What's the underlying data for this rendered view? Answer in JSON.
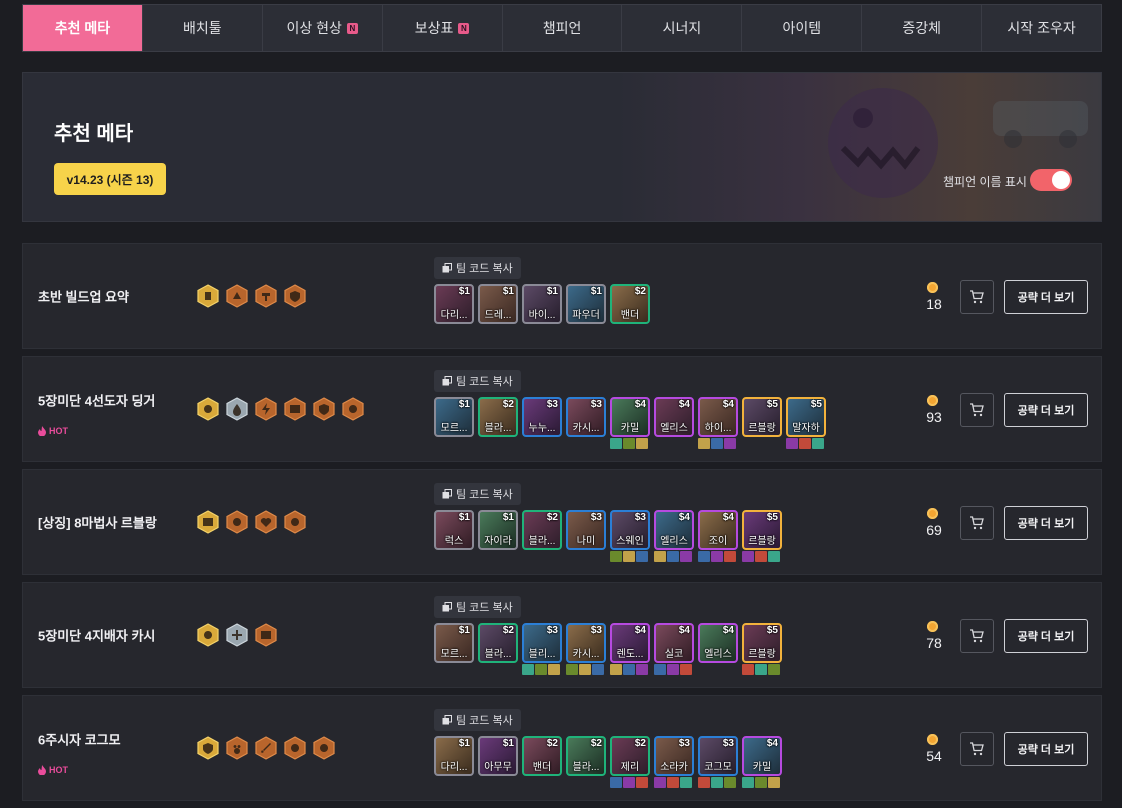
{
  "nav": {
    "items": [
      {
        "label": "추천 메타",
        "active": true,
        "badge": ""
      },
      {
        "label": "배치툴",
        "active": false,
        "badge": ""
      },
      {
        "label": "이상 현상",
        "active": false,
        "badge": "N"
      },
      {
        "label": "보상표",
        "active": false,
        "badge": "N"
      },
      {
        "label": "챔피언",
        "active": false,
        "badge": ""
      },
      {
        "label": "시너지",
        "active": false,
        "badge": ""
      },
      {
        "label": "아이템",
        "active": false,
        "badge": ""
      },
      {
        "label": "증강체",
        "active": false,
        "badge": ""
      },
      {
        "label": "시작 조우자",
        "active": false,
        "badge": ""
      }
    ]
  },
  "hero": {
    "title": "추천 메타",
    "version": "v14.23 (시즌 13)",
    "toggle_label": "챔피언 이름 표시",
    "toggle_on": true
  },
  "common": {
    "copy_label": "팀 코드 복사",
    "more_label": "공략 더 보기",
    "hot_label": "HOT"
  },
  "colors": {
    "accent": "#f26b97",
    "version_bg": "#f7d34a",
    "toggle": "#f2646a",
    "hot": "#e94c9b",
    "cost1": "#8a8a96",
    "cost2": "#1fb37a",
    "cost3": "#2b7fd6",
    "cost4": "#b64ae0",
    "cost5": "#f2b23c"
  },
  "comps": [
    {
      "title": "초반 빌드업 요약",
      "hot": false,
      "gold": "18",
      "traits": [
        {
          "tier": "gold",
          "icon": "fist-icon"
        },
        {
          "tier": "bronze",
          "icon": "arrow-icon"
        },
        {
          "tier": "bronze",
          "icon": "hammer-icon"
        },
        {
          "tier": "bronze",
          "icon": "shield-icon"
        }
      ],
      "champions": [
        {
          "name": "다리...",
          "cost": "$1",
          "tier": 1,
          "items": 0
        },
        {
          "name": "드레...",
          "cost": "$1",
          "tier": 1,
          "items": 0
        },
        {
          "name": "바이...",
          "cost": "$1",
          "tier": 1,
          "items": 0
        },
        {
          "name": "파우더",
          "cost": "$1",
          "tier": 1,
          "items": 0
        },
        {
          "name": "밴더",
          "cost": "$2",
          "tier": 2,
          "items": 0
        }
      ]
    },
    {
      "title": "5장미단 4선도자 딩거",
      "hot": true,
      "gold": "93",
      "traits": [
        {
          "tier": "gold",
          "icon": "gear-icon"
        },
        {
          "tier": "silver",
          "icon": "drop-icon"
        },
        {
          "tier": "bronze",
          "icon": "bolt-icon"
        },
        {
          "tier": "bronze",
          "icon": "book-icon"
        },
        {
          "tier": "bronze",
          "icon": "shield-icon"
        },
        {
          "tier": "bronze",
          "icon": "rose-icon"
        }
      ],
      "champions": [
        {
          "name": "모르...",
          "cost": "$1",
          "tier": 1,
          "items": 0
        },
        {
          "name": "블라...",
          "cost": "$2",
          "tier": 2,
          "items": 0
        },
        {
          "name": "누누...",
          "cost": "$3",
          "tier": 3,
          "items": 0
        },
        {
          "name": "카시...",
          "cost": "$3",
          "tier": 3,
          "items": 0
        },
        {
          "name": "카밀",
          "cost": "$4",
          "tier": 4,
          "items": 3
        },
        {
          "name": "엘리스",
          "cost": "$4",
          "tier": 4,
          "items": 0
        },
        {
          "name": "하이...",
          "cost": "$4",
          "tier": 4,
          "items": 3
        },
        {
          "name": "르블랑",
          "cost": "$5",
          "tier": 5,
          "items": 0
        },
        {
          "name": "말자하",
          "cost": "$5",
          "tier": 5,
          "items": 3
        }
      ]
    },
    {
      "title": "[상징] 8마법사 르블랑",
      "hot": false,
      "gold": "69",
      "traits": [
        {
          "tier": "gold",
          "icon": "book-icon"
        },
        {
          "tier": "bronze",
          "icon": "gear-icon"
        },
        {
          "tier": "bronze",
          "icon": "heart-icon"
        },
        {
          "tier": "bronze",
          "icon": "rose-icon"
        }
      ],
      "champions": [
        {
          "name": "럭스",
          "cost": "$1",
          "tier": 1,
          "items": 0
        },
        {
          "name": "자이라",
          "cost": "$1",
          "tier": 1,
          "items": 0
        },
        {
          "name": "블라...",
          "cost": "$2",
          "tier": 2,
          "items": 0
        },
        {
          "name": "나미",
          "cost": "$3",
          "tier": 3,
          "items": 0
        },
        {
          "name": "스웨인",
          "cost": "$3",
          "tier": 3,
          "items": 3
        },
        {
          "name": "엘리스",
          "cost": "$4",
          "tier": 4,
          "items": 3
        },
        {
          "name": "조이",
          "cost": "$4",
          "tier": 4,
          "items": 3
        },
        {
          "name": "르블랑",
          "cost": "$5",
          "tier": 5,
          "items": 3
        }
      ]
    },
    {
      "title": "5장미단 4지배자 카시",
      "hot": false,
      "gold": "78",
      "traits": [
        {
          "tier": "gold",
          "icon": "gear-icon"
        },
        {
          "tier": "silver",
          "icon": "cross-icon"
        },
        {
          "tier": "bronze",
          "icon": "book-icon"
        }
      ],
      "champions": [
        {
          "name": "모르...",
          "cost": "$1",
          "tier": 1,
          "items": 0
        },
        {
          "name": "블라...",
          "cost": "$2",
          "tier": 2,
          "items": 0
        },
        {
          "name": "블리...",
          "cost": "$3",
          "tier": 3,
          "items": 3
        },
        {
          "name": "카시...",
          "cost": "$3",
          "tier": 3,
          "items": 3
        },
        {
          "name": "렌도...",
          "cost": "$4",
          "tier": 4,
          "items": 3
        },
        {
          "name": "실코",
          "cost": "$4",
          "tier": 4,
          "items": 3
        },
        {
          "name": "엘리스",
          "cost": "$4",
          "tier": 4,
          "items": 0
        },
        {
          "name": "르블랑",
          "cost": "$5",
          "tier": 5,
          "items": 3
        }
      ]
    },
    {
      "title": "6주시자 코그모",
      "hot": true,
      "gold": "54",
      "traits": [
        {
          "tier": "gold",
          "icon": "shield-icon"
        },
        {
          "tier": "bronze",
          "icon": "paw-icon"
        },
        {
          "tier": "bronze",
          "icon": "sword-icon"
        },
        {
          "tier": "bronze",
          "icon": "cog-icon"
        },
        {
          "tier": "bronze",
          "icon": "rose-icon"
        }
      ],
      "champions": [
        {
          "name": "다리...",
          "cost": "$1",
          "tier": 1,
          "items": 0
        },
        {
          "name": "아무무",
          "cost": "$1",
          "tier": 1,
          "items": 0
        },
        {
          "name": "밴더",
          "cost": "$2",
          "tier": 2,
          "items": 0
        },
        {
          "name": "블라...",
          "cost": "$2",
          "tier": 2,
          "items": 0
        },
        {
          "name": "제리",
          "cost": "$2",
          "tier": 2,
          "items": 3
        },
        {
          "name": "소라카",
          "cost": "$3",
          "tier": 3,
          "items": 3
        },
        {
          "name": "코그모",
          "cost": "$3",
          "tier": 3,
          "items": 3
        },
        {
          "name": "카밀",
          "cost": "$4",
          "tier": 4,
          "items": 3
        }
      ]
    }
  ]
}
